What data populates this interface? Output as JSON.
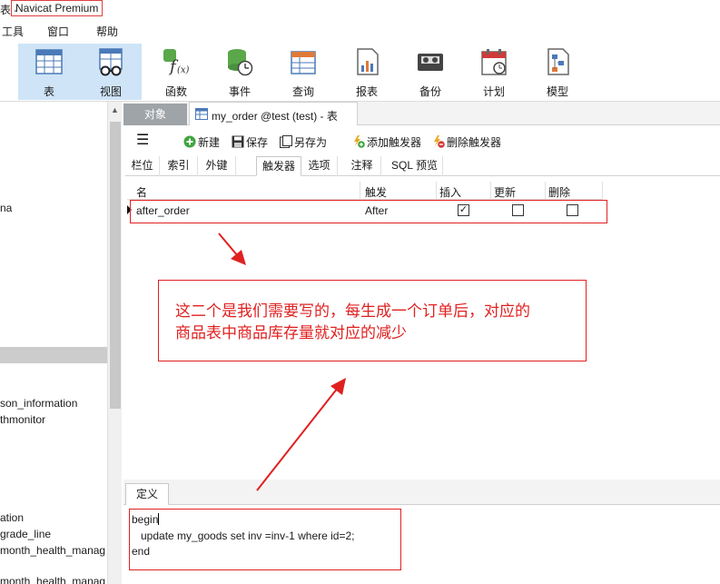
{
  "window": {
    "title_prefix": "表 -",
    "app_name": "Navicat Premium"
  },
  "menu": {
    "tools": "工具",
    "window": "窗口",
    "help": "帮助"
  },
  "toolbar": {
    "items": [
      {
        "label": "表",
        "icon": "table-icon",
        "active": true
      },
      {
        "label": "视图",
        "icon": "view-icon",
        "active": true
      },
      {
        "label": "函数",
        "icon": "function-icon",
        "active": false
      },
      {
        "label": "事件",
        "icon": "event-icon",
        "active": false
      },
      {
        "label": "查询",
        "icon": "query-icon",
        "active": false
      },
      {
        "label": "报表",
        "icon": "report-icon",
        "active": false
      },
      {
        "label": "备份",
        "icon": "backup-icon",
        "active": false
      },
      {
        "label": "计划",
        "icon": "schedule-icon",
        "active": false
      },
      {
        "label": "模型",
        "icon": "model-icon",
        "active": false
      }
    ]
  },
  "left_tree": {
    "items": [
      "na",
      "son_information",
      "thmonitor",
      "ation",
      "grade_line",
      "month_health_manag",
      "month_health_manag"
    ]
  },
  "tabs": {
    "objects": "对象",
    "document": "my_order @test (test) - 表"
  },
  "subtoolbar": {
    "new": "新建",
    "save": "保存",
    "save_as": "另存为",
    "add_trigger": "添加触发器",
    "delete_trigger": "删除触发器"
  },
  "design_tabs": [
    "栏位",
    "索引",
    "外键",
    "触发器",
    "选项",
    "注释",
    "SQL 预览"
  ],
  "trigger_grid": {
    "headers": [
      "名",
      "触发",
      "插入",
      "更新",
      "删除"
    ],
    "rows": [
      {
        "name": "after_order",
        "timing": "After",
        "insert": true,
        "update": false,
        "delete": false
      }
    ]
  },
  "annotation": {
    "line1": "这二个是我们需要写的，每生成一个订单后，对应的",
    "line2": "商品表中商品库存量就对应的减少",
    "color": "#e02020"
  },
  "definition": {
    "tab_label": "定义",
    "code_lines": [
      "begin",
      "   update my_goods set inv =inv-1 where id=2;",
      "end"
    ]
  }
}
